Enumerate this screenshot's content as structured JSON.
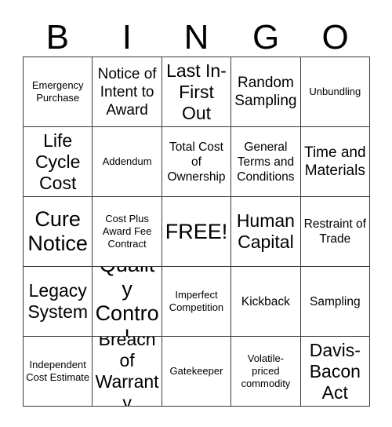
{
  "header": {
    "letters": [
      "B",
      "I",
      "N",
      "G",
      "O"
    ]
  },
  "grid": {
    "rows": 5,
    "columns": 5,
    "border_color": "#3a3a3a",
    "background_color": "#ffffff",
    "text_color": "#000000",
    "cells": [
      {
        "text": "Emergency Purchase",
        "size": "sz-sm",
        "free": false
      },
      {
        "text": "Notice of Intent to Award",
        "size": "sz-lg",
        "free": false
      },
      {
        "text": "Last In-First Out",
        "size": "sz-xl",
        "free": false
      },
      {
        "text": "Random Sampling",
        "size": "sz-lg",
        "free": false
      },
      {
        "text": "Unbundling",
        "size": "sz-sm",
        "free": false
      },
      {
        "text": "Life Cycle Cost",
        "size": "sz-xl",
        "free": false
      },
      {
        "text": "Addendum",
        "size": "sz-sm",
        "free": false
      },
      {
        "text": "Total Cost of Ownership",
        "size": "sz-md",
        "free": false
      },
      {
        "text": "General Terms and Conditions",
        "size": "sz-md",
        "free": false
      },
      {
        "text": "Time and Materials",
        "size": "sz-lg",
        "free": false
      },
      {
        "text": "Cure Notice",
        "size": "sz-xxl",
        "free": false
      },
      {
        "text": "Cost Plus Award Fee Contract",
        "size": "sz-sm",
        "free": false
      },
      {
        "text": "FREE!",
        "size": "sz-xxl",
        "free": true
      },
      {
        "text": "Human Capital",
        "size": "sz-xl",
        "free": false
      },
      {
        "text": "Restraint of Trade",
        "size": "sz-md",
        "free": false
      },
      {
        "text": "Legacy System",
        "size": "sz-xl",
        "free": false
      },
      {
        "text": "Quality Control",
        "size": "sz-xxl",
        "free": false
      },
      {
        "text": "Imperfect Competition",
        "size": "sz-sm",
        "free": false
      },
      {
        "text": "Kickback",
        "size": "sz-md",
        "free": false
      },
      {
        "text": "Sampling",
        "size": "sz-md",
        "free": false
      },
      {
        "text": "Independent Cost Estimate",
        "size": "sz-sm",
        "free": false
      },
      {
        "text": "Breach of Warranty",
        "size": "sz-xl",
        "free": false
      },
      {
        "text": "Gatekeeper",
        "size": "sz-sm",
        "free": false
      },
      {
        "text": "Volatile-priced commodity",
        "size": "sz-sm",
        "free": false
      },
      {
        "text": "Davis-Bacon Act",
        "size": "sz-xl",
        "free": false
      }
    ]
  }
}
